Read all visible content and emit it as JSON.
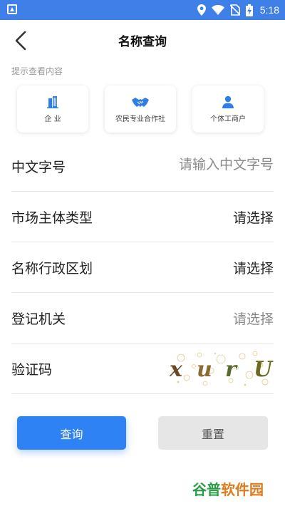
{
  "status_bar": {
    "time": "5:18"
  },
  "nav": {
    "title": "名称查询"
  },
  "hint": "提示查看内容",
  "categories": [
    {
      "label": "企 业",
      "icon": "building-icon"
    },
    {
      "label": "农民专业合作社",
      "icon": "handshake-icon"
    },
    {
      "label": "个体工商户",
      "icon": "person-icon"
    }
  ],
  "form": {
    "chinese_name": {
      "label": "中文字号",
      "placeholder": "请输入中文字号"
    },
    "entity_type": {
      "label": "市场主体类型",
      "value": "请选择"
    },
    "admin_region": {
      "label": "名称行政区划",
      "value": "请选择"
    },
    "registration_authority": {
      "label": "登记机关",
      "placeholder": "请选择"
    },
    "captcha": {
      "label": "验证码",
      "code": "xurU"
    }
  },
  "buttons": {
    "query": "查询",
    "reset": "重置"
  },
  "watermark": {
    "part1": "谷普",
    "part2": "软件园"
  },
  "colors": {
    "status_bar": "#3f7fe8",
    "primary": "#2f82f4",
    "icon_blue": "#2f7ee8"
  }
}
